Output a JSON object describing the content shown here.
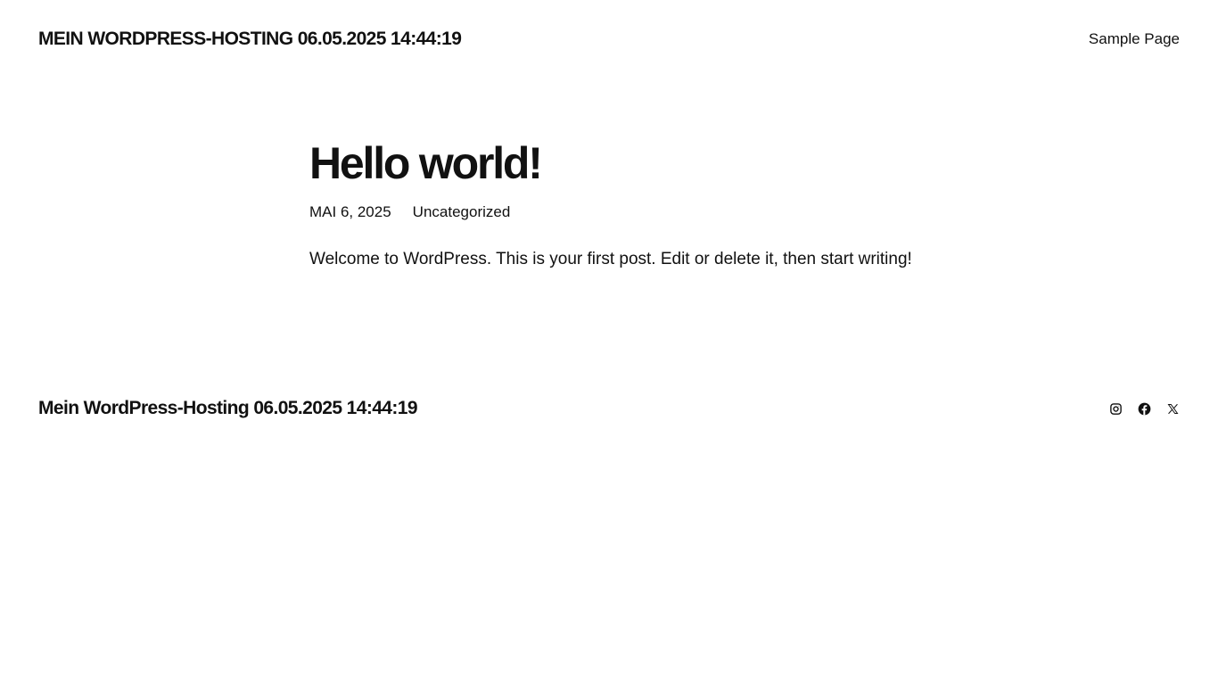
{
  "header": {
    "site_title": "MEIN WORDPRESS-HOSTING 06.05.2025 14:44:19",
    "nav": [
      {
        "label": "Sample Page"
      }
    ]
  },
  "post": {
    "title": "Hello world!",
    "date": "MAI 6, 2025",
    "category": "Uncategorized",
    "content": "Welcome to WordPress. This is your first post. Edit or delete it, then start writing!"
  },
  "footer": {
    "site_title": "Mein WordPress-Hosting 06.05.2025 14:44:19",
    "social_icons": [
      "instagram-icon",
      "facebook-icon",
      "x-icon"
    ]
  },
  "colors": {
    "text": "#111111",
    "background": "#ffffff"
  }
}
